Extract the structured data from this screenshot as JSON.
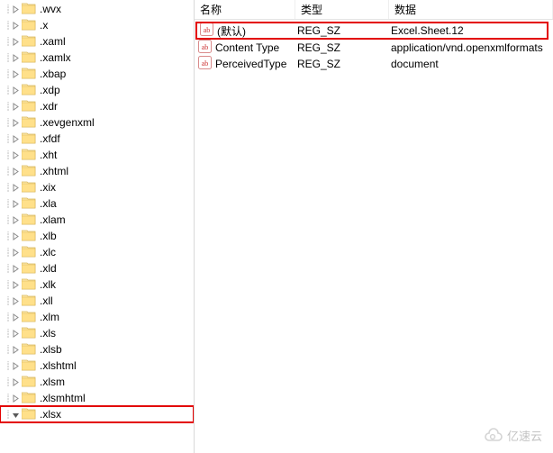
{
  "tree": {
    "items": [
      {
        "label": ".wvx",
        "expanded": false,
        "selected": false
      },
      {
        "label": ".x",
        "expanded": false,
        "selected": false
      },
      {
        "label": ".xaml",
        "expanded": false,
        "selected": false
      },
      {
        "label": ".xamlx",
        "expanded": false,
        "selected": false
      },
      {
        "label": ".xbap",
        "expanded": false,
        "selected": false
      },
      {
        "label": ".xdp",
        "expanded": false,
        "selected": false
      },
      {
        "label": ".xdr",
        "expanded": false,
        "selected": false
      },
      {
        "label": ".xevgenxml",
        "expanded": false,
        "selected": false
      },
      {
        "label": ".xfdf",
        "expanded": false,
        "selected": false
      },
      {
        "label": ".xht",
        "expanded": false,
        "selected": false
      },
      {
        "label": ".xhtml",
        "expanded": false,
        "selected": false
      },
      {
        "label": ".xix",
        "expanded": false,
        "selected": false
      },
      {
        "label": ".xla",
        "expanded": false,
        "selected": false
      },
      {
        "label": ".xlam",
        "expanded": false,
        "selected": false
      },
      {
        "label": ".xlb",
        "expanded": false,
        "selected": false
      },
      {
        "label": ".xlc",
        "expanded": false,
        "selected": false
      },
      {
        "label": ".xld",
        "expanded": false,
        "selected": false
      },
      {
        "label": ".xlk",
        "expanded": false,
        "selected": false
      },
      {
        "label": ".xll",
        "expanded": false,
        "selected": false
      },
      {
        "label": ".xlm",
        "expanded": false,
        "selected": false
      },
      {
        "label": ".xls",
        "expanded": false,
        "selected": false
      },
      {
        "label": ".xlsb",
        "expanded": false,
        "selected": false
      },
      {
        "label": ".xlshtml",
        "expanded": false,
        "selected": false
      },
      {
        "label": ".xlsm",
        "expanded": false,
        "selected": false
      },
      {
        "label": ".xlsmhtml",
        "expanded": false,
        "selected": false
      },
      {
        "label": ".xlsx",
        "expanded": true,
        "selected": true
      }
    ]
  },
  "list": {
    "columns": {
      "name": "名称",
      "type": "类型",
      "data": "数据"
    },
    "rows": [
      {
        "icon": "string",
        "name": "(默认)",
        "type": "REG_SZ",
        "data": "Excel.Sheet.12",
        "selected": true
      },
      {
        "icon": "string",
        "name": "Content Type",
        "type": "REG_SZ",
        "data": "application/vnd.openxmlformats",
        "selected": false
      },
      {
        "icon": "string",
        "name": "PerceivedType",
        "type": "REG_SZ",
        "data": "document",
        "selected": false
      }
    ]
  },
  "watermark": {
    "text": "亿速云"
  }
}
